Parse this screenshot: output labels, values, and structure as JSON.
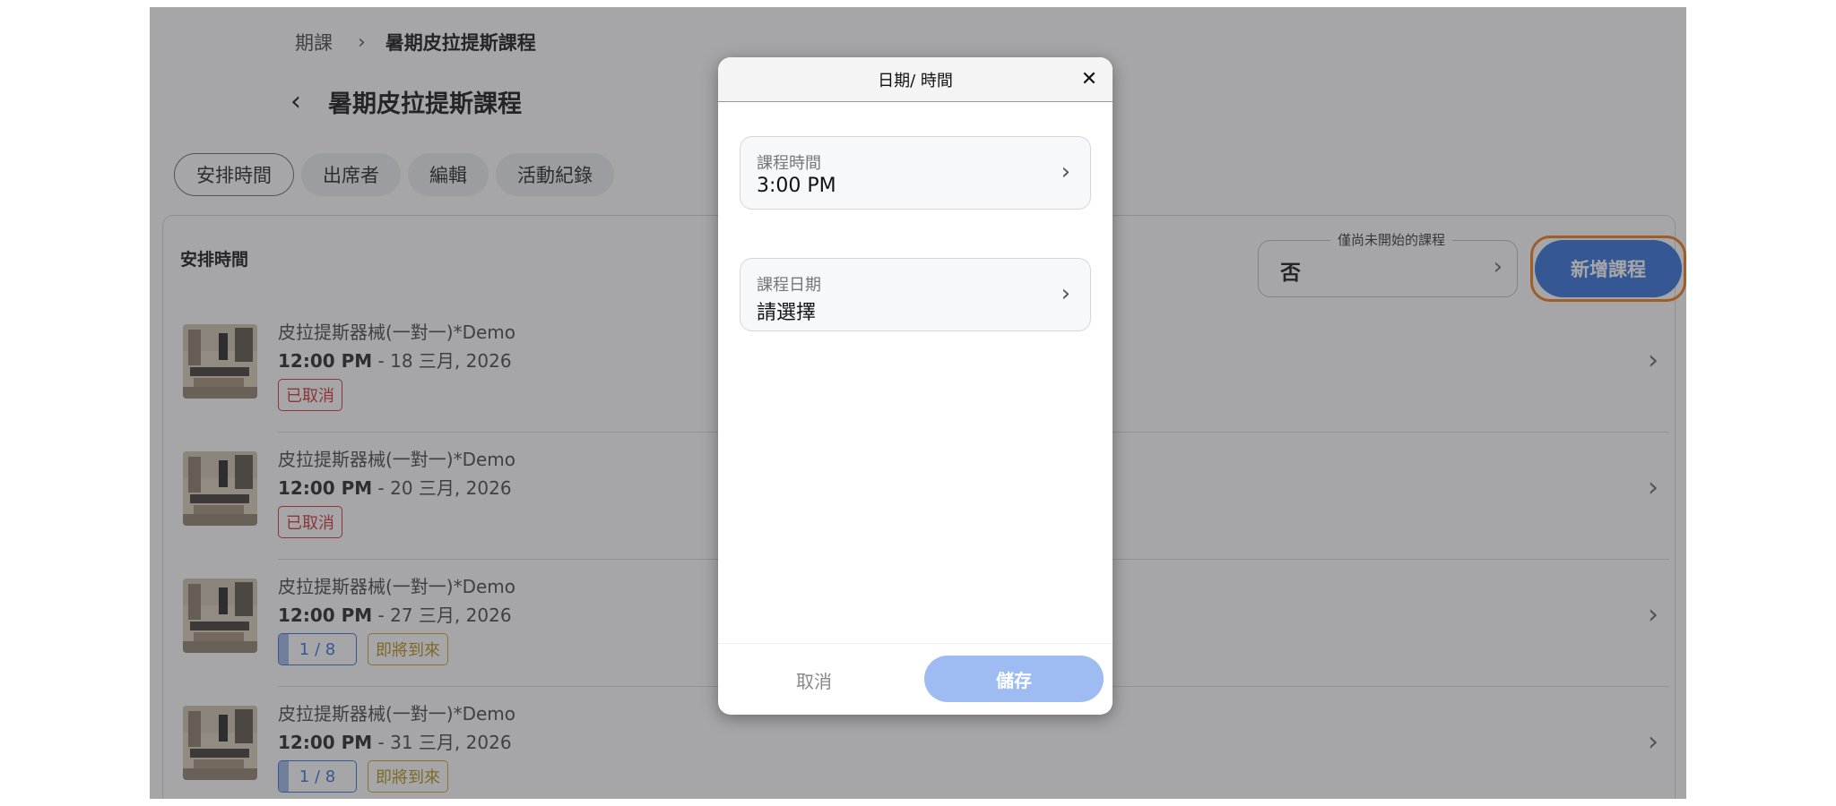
{
  "breadcrumb": {
    "parent": "期課",
    "separator": "›",
    "current": "暑期皮拉提斯課程"
  },
  "page_title": "暑期皮拉提斯課程",
  "tabs": [
    {
      "label": "安排時間",
      "active": true
    },
    {
      "label": "出席者",
      "active": false
    },
    {
      "label": "編輯",
      "active": false
    },
    {
      "label": "活動紀錄",
      "active": false
    }
  ],
  "schedule": {
    "title": "安排時間",
    "filter": {
      "label": "僅尚未開始的課程",
      "value": "否"
    },
    "add_button": "新增課程",
    "courses": [
      {
        "name": "皮拉提斯器械(一對一)*Demo",
        "time": "12:00 PM",
        "date": " - 18 三月, 2026",
        "badges": [
          {
            "type": "red",
            "text": "已取消"
          }
        ]
      },
      {
        "name": "皮拉提斯器械(一對一)*Demo",
        "time": "12:00 PM",
        "date": " - 20 三月, 2026",
        "badges": [
          {
            "type": "red",
            "text": "已取消"
          }
        ]
      },
      {
        "name": "皮拉提斯器械(一對一)*Demo",
        "time": "12:00 PM",
        "date": " - 27 三月, 2026",
        "badges": [
          {
            "type": "blue",
            "text": "1 / 8",
            "fill": 0.125
          },
          {
            "type": "gold",
            "text": "即將到來"
          }
        ]
      },
      {
        "name": "皮拉提斯器械(一對一)*Demo",
        "time": "12:00 PM",
        "date": " - 31 三月, 2026",
        "badges": [
          {
            "type": "blue",
            "text": "1 / 8",
            "fill": 0.125
          },
          {
            "type": "gold",
            "text": "即將到來"
          }
        ]
      }
    ]
  },
  "modal": {
    "title": "日期/ 時間",
    "close_icon": "close-icon",
    "time_field": {
      "label": "課程時間",
      "value": "3:00 PM"
    },
    "date_field": {
      "label": "課程日期",
      "value": "請選擇"
    },
    "cancel": "取消",
    "save": "儲存"
  },
  "colors": {
    "primary": "#2f6fdc",
    "highlight": "#f07a19",
    "danger": "#d32f2f",
    "warning": "#c9a21f"
  }
}
